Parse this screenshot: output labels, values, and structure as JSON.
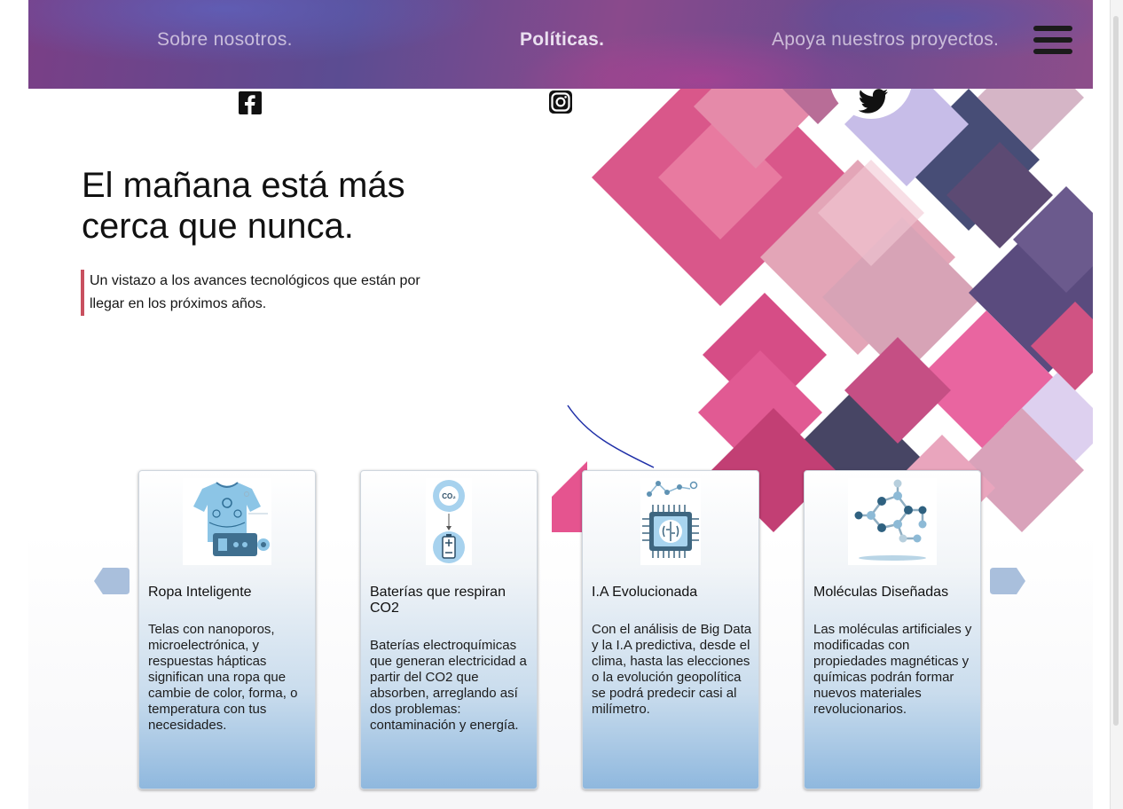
{
  "nav": {
    "about": "Sobre nosotros.",
    "policies": "Políticas.",
    "support": "Apoya nuestros proyectos."
  },
  "social": {
    "facebook_icon": "facebook-icon",
    "instagram_icon": "instagram-icon",
    "twitter_icon": "twitter-icon"
  },
  "hero": {
    "title_line1": "El mañana está más",
    "title_line2": "cerca que nunca.",
    "subtitle_line1": "Un vistazo a los avances tecnológicos que están por",
    "subtitle_line2": "llegar en los próximos años."
  },
  "cards": [
    {
      "icon": "smart-clothing-icon",
      "title": "Ropa Inteligente",
      "text": "Telas con nanoporos, microelectrónica, y respuestas hápticas significan una ropa que cambie de color, forma, o temperatura con tus necesidades."
    },
    {
      "icon": "co2-battery-icon",
      "title": "Baterías que respiran CO2",
      "text": "Baterías electroquímicas que generan electricidad a partir del CO2 que absorben, arreglando así dos problemas: contaminación y energía.",
      "image_label": "CO₂"
    },
    {
      "icon": "ai-chip-icon",
      "title": "I.A Evolucionada",
      "text": "Con el análisis de Big Data y la I.A predictiva, desde el clima, hasta las elecciones o la evolución geopolítica se podrá predecir casi al milímetro."
    },
    {
      "icon": "molecule-icon",
      "title": "Moléculas Diseñadas",
      "text": "Las moléculas artificiales y modificadas con propiedades magnéticas y químicas podrán formar nuevos materiales revolucionarios."
    }
  ],
  "colors": {
    "accent": "#c8505f",
    "arrow": "#a9bfdc",
    "card_gradient_bottom": "#8fb8de"
  }
}
